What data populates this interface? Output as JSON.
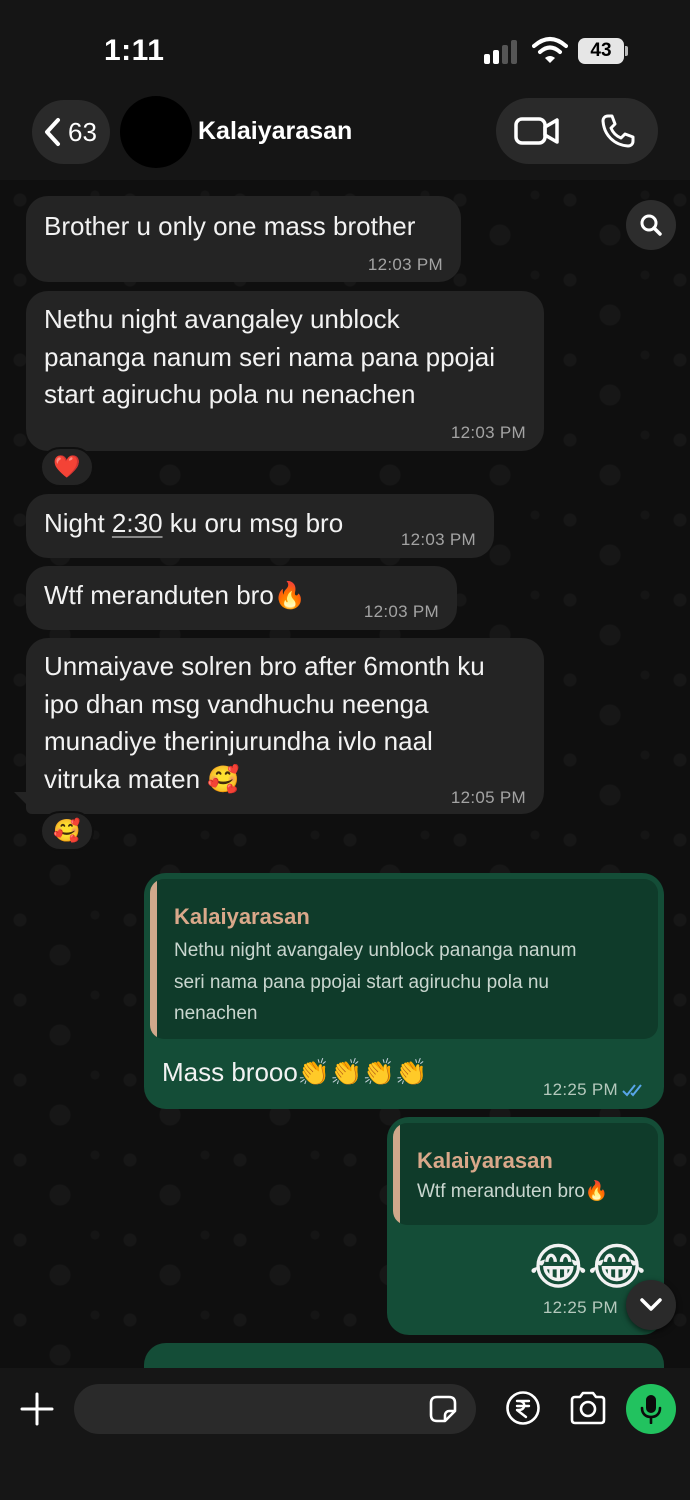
{
  "status_bar": {
    "time": "1:11",
    "battery": "43"
  },
  "header": {
    "back_count": "63",
    "contact_name": "Kalaiyarasan"
  },
  "messages": [
    {
      "text": "Brother u only one mass brother",
      "time": "12:03 PM"
    },
    {
      "lines": [
        "Nethu night avangaley unblock",
        "pananga nanum seri nama pana ppojai",
        "start agiruchu pola nu nenachen"
      ],
      "time": "12:03 PM",
      "reaction": "❤️"
    },
    {
      "text_before": "Night ",
      "text_link": "2:30",
      "text_after": " ku oru msg bro",
      "time": "12:03 PM"
    },
    {
      "text": "Wtf meranduten bro🔥",
      "time": "12:03 PM"
    },
    {
      "lines": [
        "Unmaiyave solren bro after 6month ku",
        "ipo dhan msg vandhuchu neenga",
        "munadiye therinjurundha ivlo naal",
        "vitruka maten 🥰"
      ],
      "time": "12:05 PM",
      "reaction": "🥰"
    }
  ],
  "sent": [
    {
      "quote_name": "Kalaiyarasan",
      "quote_lines": [
        "Nethu night avangaley unblock pananga nanum",
        "seri nama pana ppojai start agiruchu pola nu",
        "nenachen"
      ],
      "text": "Mass brooo👏👏👏👏",
      "time": "12:25 PM"
    },
    {
      "quote_name": "Kalaiyarasan",
      "quote_text": "Wtf meranduten bro🔥",
      "text": "😂😂",
      "time": "12:25 PM"
    }
  ],
  "input": {
    "placeholder": ""
  }
}
